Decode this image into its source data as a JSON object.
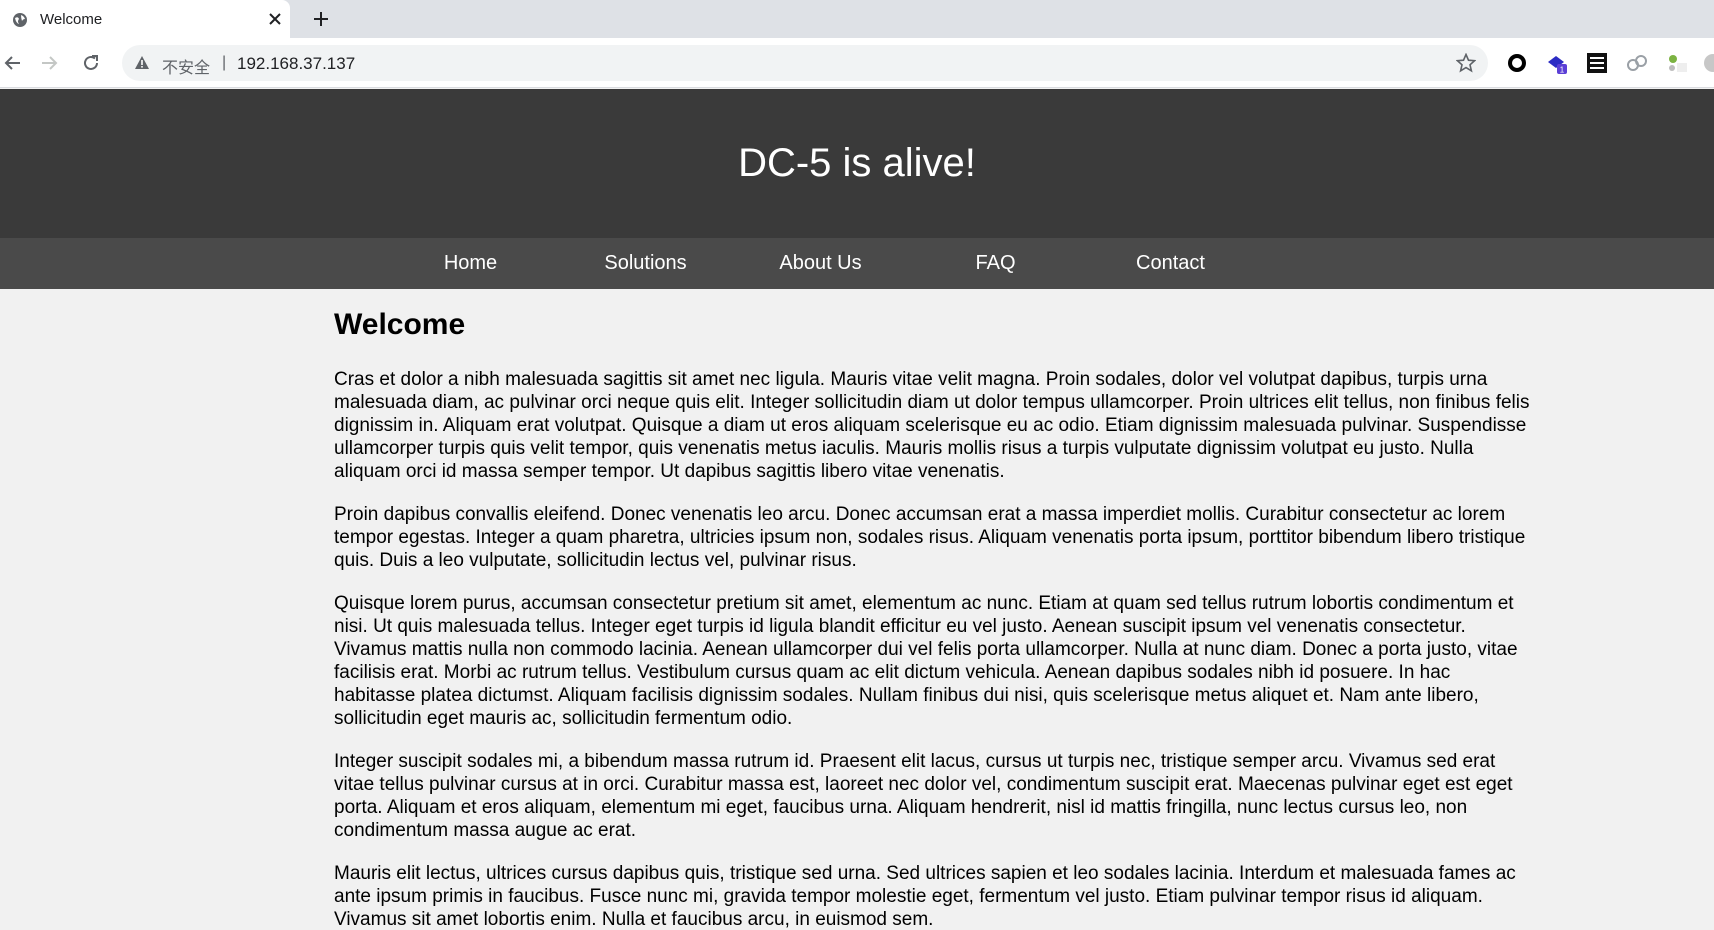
{
  "browser": {
    "tab_title": "Welcome",
    "insecure_label": "不安全",
    "separator": "|",
    "url": "192.168.37.137",
    "extension_badge": "1"
  },
  "site": {
    "title": "DC-5 is alive!",
    "nav": [
      {
        "label": "Home"
      },
      {
        "label": "Solutions"
      },
      {
        "label": "About Us"
      },
      {
        "label": "FAQ"
      },
      {
        "label": "Contact"
      }
    ],
    "heading": "Welcome",
    "paragraphs": [
      "Cras et dolor a nibh malesuada sagittis sit amet nec ligula. Mauris vitae velit magna. Proin sodales, dolor vel volutpat dapibus, turpis urna malesuada diam, ac pulvinar orci neque quis elit. Integer sollicitudin diam ut dolor tempus ullamcorper. Proin ultrices elit tellus, non finibus felis dignissim in. Aliquam erat volutpat. Quisque a diam ut eros aliquam scelerisque eu ac odio. Etiam dignissim malesuada pulvinar. Suspendisse ullamcorper turpis quis velit tempor, quis venenatis metus iaculis. Mauris mollis risus a turpis vulputate dignissim volutpat eu justo. Nulla aliquam orci id massa semper tempor. Ut dapibus sagittis libero vitae venenatis.",
      "Proin dapibus convallis eleifend. Donec venenatis leo arcu. Donec accumsan erat a massa imperdiet mollis. Curabitur consectetur ac lorem tempor egestas. Integer a quam pharetra, ultricies ipsum non, sodales risus. Aliquam venenatis porta ipsum, porttitor bibendum libero tristique quis. Duis a leo vulputate, sollicitudin lectus vel, pulvinar risus.",
      "Quisque lorem purus, accumsan consectetur pretium sit amet, elementum ac nunc. Etiam at quam sed tellus rutrum lobortis condimentum et nisi. Ut quis malesuada tellus. Integer eget turpis id ligula blandit efficitur eu vel justo. Aenean suscipit ipsum vel venenatis consectetur. Vivamus mattis nulla non commodo lacinia. Aenean ullamcorper dui vel felis porta ullamcorper. Nulla at nunc diam. Donec a porta justo, vitae facilisis erat. Morbi ac rutrum tellus. Vestibulum cursus quam ac elit dictum vehicula. Aenean dapibus sodales nibh id posuere. In hac habitasse platea dictumst. Aliquam facilisis dignissim sodales. Nullam finibus dui nisi, quis scelerisque metus aliquet et. Nam ante libero, sollicitudin eget mauris ac, sollicitudin fermentum odio.",
      "Integer suscipit sodales mi, a bibendum massa rutrum id. Praesent elit lacus, cursus ut turpis nec, tristique semper arcu. Vivamus sed erat vitae tellus pulvinar cursus at in orci. Curabitur massa est, laoreet nec dolor vel, condimentum suscipit erat. Maecenas pulvinar eget est eget porta. Aliquam et eros aliquam, elementum mi eget, faucibus urna. Aliquam hendrerit, nisl id mattis fringilla, nunc lectus cursus leo, non condimentum massa augue ac erat.",
      "Mauris elit lectus, ultrices cursus dapibus quis, tristique sed urna. Sed ultrices sapien et leo sodales lacinia. Interdum et malesuada fames ac ante ipsum primis in faucibus. Fusce nunc mi, gravida tempor molestie eget, fermentum vel justo. Etiam pulvinar tempor risus id aliquam. Vivamus sit amet lobortis enim. Nulla et faucibus arcu, in euismod sem."
    ]
  },
  "colors": {
    "header_bg": "#3a3a3a",
    "nav_bg": "#4a4a4a",
    "page_bg": "#f1f1f1"
  }
}
